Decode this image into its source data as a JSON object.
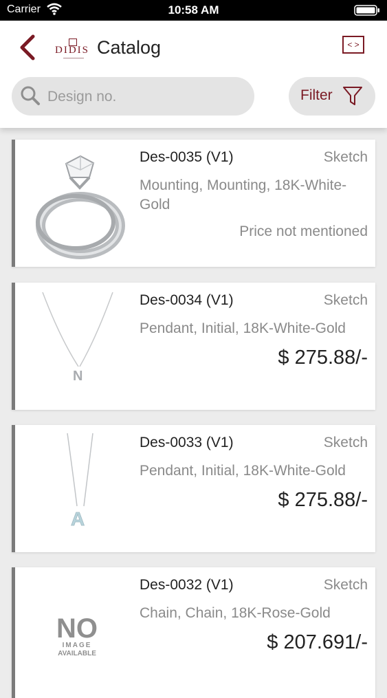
{
  "status_bar": {
    "carrier": "Carrier",
    "time": "10:58 AM"
  },
  "header": {
    "title": "Catalog",
    "logo_text": "DIDIS",
    "search_placeholder": "Design no.",
    "filter_label": "Filter"
  },
  "items": [
    {
      "design_no": "Des-0035 (V1)",
      "type": "Sketch",
      "description": "Mounting, Mounting, 18K-White-Gold",
      "price": "Price not mentioned",
      "image": "ring-image"
    },
    {
      "design_no": "Des-0034 (V1)",
      "type": "Sketch",
      "description": "Pendant, Initial, 18K-White-Gold",
      "price": "$ 275.88/-",
      "image": "pendant-n-image"
    },
    {
      "design_no": "Des-0033 (V1)",
      "type": "Sketch",
      "description": "Pendant, Initial, 18K-White-Gold",
      "price": "$ 275.88/-",
      "image": "pendant-a-image"
    },
    {
      "design_no": "Des-0032 (V1)",
      "type": "Sketch",
      "description": "Chain, Chain, 18K-Rose-Gold",
      "price": "$ 207.691/-",
      "image": "no-image-placeholder",
      "placeholder_lines": [
        "NO",
        "IMAGE",
        "AVAILABLE"
      ]
    }
  ],
  "colors": {
    "accent": "#7a1a24",
    "card_border": "#7b7b7b",
    "muted_text": "#8a8a8a"
  }
}
